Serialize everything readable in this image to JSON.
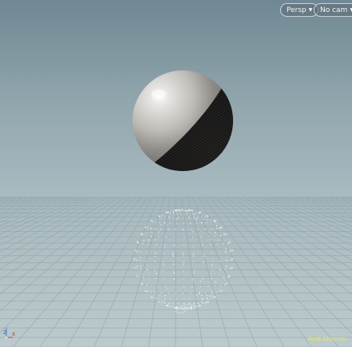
{
  "viewport": {
    "projection_menu": {
      "label": "Persp",
      "icon": "chevron-down-icon"
    },
    "camera_menu": {
      "label": "No cam",
      "icon": "chevron-down-icon"
    },
    "status_hint": "Field Obscure",
    "axis_gizmo": {
      "icon": "axis-gizmo-icon",
      "labels": {
        "up": "Z",
        "right": "X"
      }
    },
    "colors": {
      "sky_top": "#6f8893",
      "sky_horizon": "#a7b9bf",
      "ground": "#b5c6ca",
      "grid_line": "#90a3a8",
      "menu_border": "#c7d4d9",
      "status_text": "#e9e76c",
      "axis_z": "#4f8ed8",
      "axis_x": "#d84e4e"
    }
  }
}
